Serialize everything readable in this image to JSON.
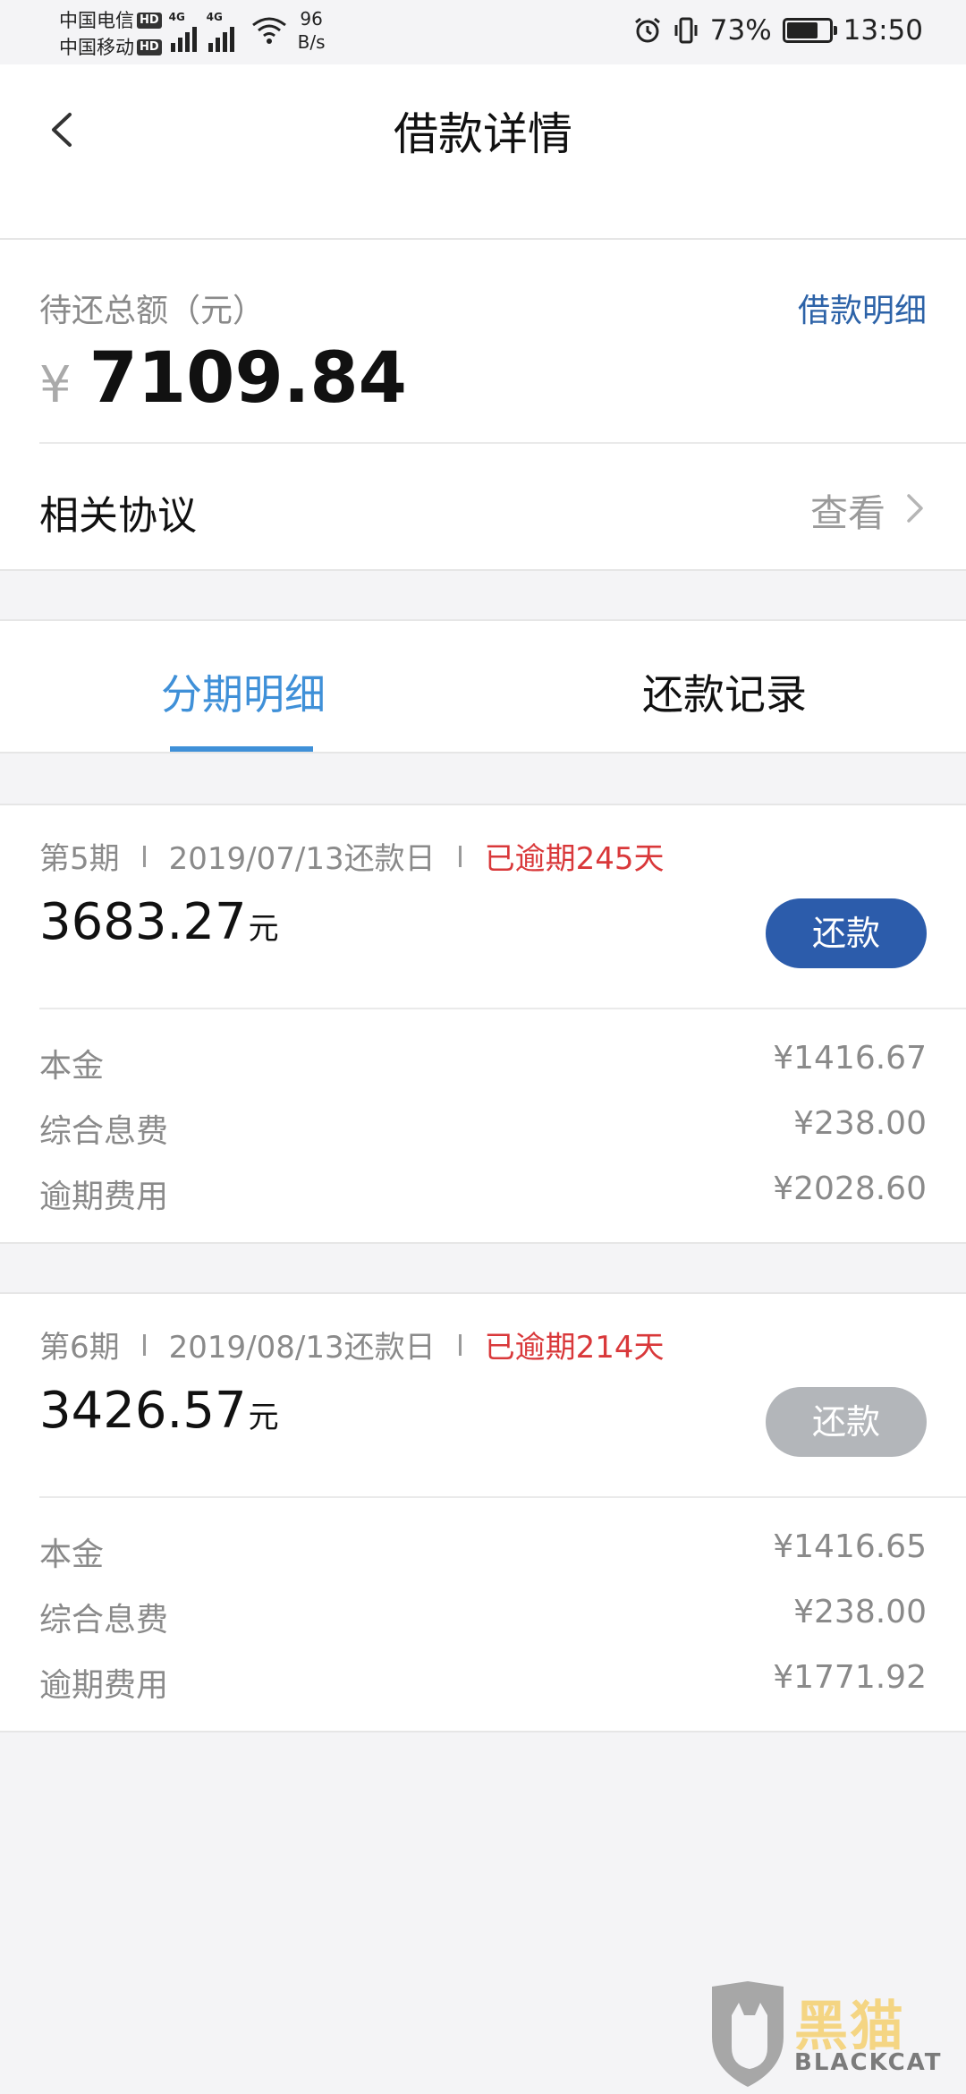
{
  "status_bar": {
    "carriers": [
      "中国电信",
      "中国移动"
    ],
    "hd_badge": "HD",
    "network_type": "4G",
    "speed_value": "96",
    "speed_unit": "B/s",
    "battery_percent": "73%",
    "battery_level": 0.73,
    "time": "13:50"
  },
  "nav": {
    "title": "借款详情"
  },
  "summary": {
    "label": "待还总额（元）",
    "detail_link": "借款明细",
    "currency": "¥",
    "amount": "7109.84",
    "agreement_label": "相关协议",
    "view_label": "查看"
  },
  "tabs": [
    {
      "label": "分期明细",
      "active": true
    },
    {
      "label": "还款记录",
      "active": false
    }
  ],
  "installments": [
    {
      "period": "第5期",
      "due": "2019/07/13还款日",
      "status": "已逾期245天",
      "amount": "3683.27",
      "unit": "元",
      "button": "还款",
      "button_enabled": true,
      "rows": [
        {
          "label": "本金",
          "value": "¥1416.67"
        },
        {
          "label": "综合息费",
          "value": "¥238.00"
        },
        {
          "label": "逾期费用",
          "value": "¥2028.60"
        }
      ]
    },
    {
      "period": "第6期",
      "due": "2019/08/13还款日",
      "status": "已逾期214天",
      "amount": "3426.57",
      "unit": "元",
      "button": "还款",
      "button_enabled": false,
      "rows": [
        {
          "label": "本金",
          "value": "¥1416.65"
        },
        {
          "label": "综合息费",
          "value": "¥238.00"
        },
        {
          "label": "逾期费用",
          "value": "¥1771.92"
        }
      ]
    }
  ],
  "watermark": {
    "text": "黑猫",
    "subtext": "BLACKCAT"
  },
  "colors": {
    "accent": "#3f90d8",
    "link": "#2d63a8",
    "overdue": "#d9383a",
    "button_active": "#2c5cab",
    "button_disabled": "#b3b6ba"
  }
}
